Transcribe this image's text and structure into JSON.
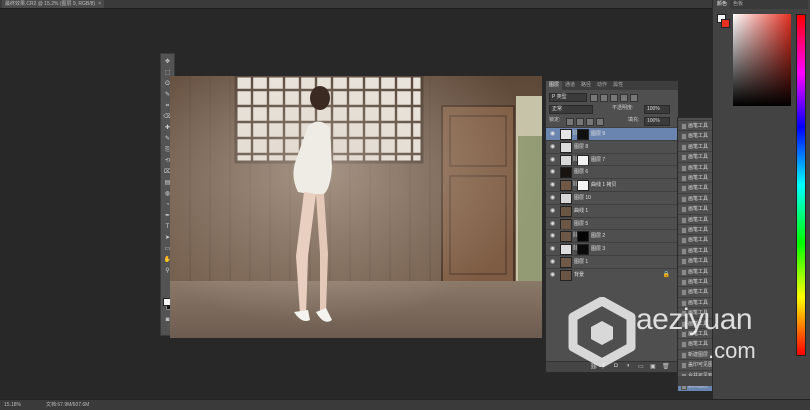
{
  "document_tab": {
    "title": "最终效果.CR2 @ 15.2% (图层 9, RGB/8)",
    "close": "×"
  },
  "toolbox": {
    "tools": [
      "move-icon",
      "marquee-icon",
      "lasso-icon",
      "quick-select-icon",
      "crop-icon",
      "eyedropper-icon",
      "healing-brush-icon",
      "brush-icon",
      "clone-stamp-icon",
      "history-brush-icon",
      "eraser-icon",
      "gradient-icon",
      "blur-icon",
      "dodge-icon",
      "pen-icon",
      "type-icon",
      "path-select-icon",
      "shape-icon",
      "hand-icon",
      "zoom-icon"
    ],
    "glyphs": [
      "✥",
      "⬚",
      "ʘ",
      "✎",
      "⌗",
      "⌫",
      "✚",
      "✎",
      "⎘",
      "⟲",
      "⌧",
      "▤",
      "◍",
      "◔",
      "✒",
      "T",
      "➤",
      "▭",
      "✋",
      "⚲"
    ]
  },
  "layers_panel": {
    "tabs": [
      "图层",
      "通道",
      "路径",
      "动作",
      "属性"
    ],
    "kind_filter": "P 类型",
    "blend_mode": "正常",
    "opacity_label": "不透明度:",
    "opacity_value": "100%",
    "lock_label": "锁定:",
    "fill_label": "填充:",
    "fill_value": "100%",
    "layers": [
      {
        "name": "图层 9",
        "selected": true,
        "thumb": "#e6e6e6",
        "mask": "#101010"
      },
      {
        "name": "图层 8",
        "selected": false,
        "thumb": "#dcdcdc",
        "mask": ""
      },
      {
        "name": "图层 7",
        "selected": false,
        "thumb": "#d9d9d9",
        "mask": "#f2f2f2"
      },
      {
        "name": "图层 6",
        "selected": false,
        "thumb": "#1a1410",
        "mask": ""
      },
      {
        "name": "曲线 1 拷贝",
        "selected": false,
        "thumb": "#6f5846",
        "mask": "#f5f5f5"
      },
      {
        "name": "图层 10",
        "selected": false,
        "thumb": "#d7d7d7",
        "mask": ""
      },
      {
        "name": "曲线 1",
        "selected": false,
        "thumb": "#6a5442",
        "mask": ""
      },
      {
        "name": "图层 5",
        "selected": false,
        "thumb": "#6b5545",
        "mask": ""
      },
      {
        "name": "图层 2",
        "selected": false,
        "thumb": "#6d5746",
        "mask": "#050505"
      },
      {
        "name": "图层 3",
        "selected": false,
        "thumb": "#dddddd",
        "mask": "#0a0a0a"
      },
      {
        "name": "图层 1",
        "selected": false,
        "thumb": "#6f5948",
        "mask": ""
      },
      {
        "name": "背景",
        "selected": false,
        "thumb": "#6a5443",
        "mask": ""
      }
    ],
    "lock_glyph": "🔒",
    "bottom_icons": [
      "link-icon",
      "fx-icon",
      "mask-icon",
      "adjustment-icon",
      "group-icon",
      "new-layer-icon",
      "trash-icon"
    ]
  },
  "history_panel": {
    "items": [
      "画笔工具",
      "画笔工具",
      "画笔工具",
      "画笔工具",
      "画笔工具",
      "画笔工具",
      "画笔工具",
      "画笔工具",
      "画笔工具",
      "画笔工具",
      "画笔工具",
      "画笔工具",
      "画笔工具",
      "画笔工具",
      "画笔工具",
      "画笔工具",
      "画笔工具",
      "画笔工具",
      "画笔工具",
      "画笔工具",
      "画笔工具",
      "画笔工具",
      "画笔工具",
      "画笔工具",
      "画笔工具",
      "画笔工具",
      "画笔工具",
      "画笔工具",
      "画笔工具",
      "画笔工具",
      "盖印可见图层",
      "删除图层",
      "删除图层"
    ],
    "visible_tail": [
      "新建图层",
      "盖印可见图层",
      "合并可见到新图层",
      "删除图层"
    ],
    "current_index": 3
  },
  "color_panel": {
    "tabs": [
      "颜色",
      "色板"
    ],
    "accent": "#e53022"
  },
  "status_bar": {
    "zoom": "15.18%",
    "doc": "文档:67.9M/607.6M"
  },
  "watermark": {
    "text": "aeziyuan",
    "suffix": ".com"
  }
}
